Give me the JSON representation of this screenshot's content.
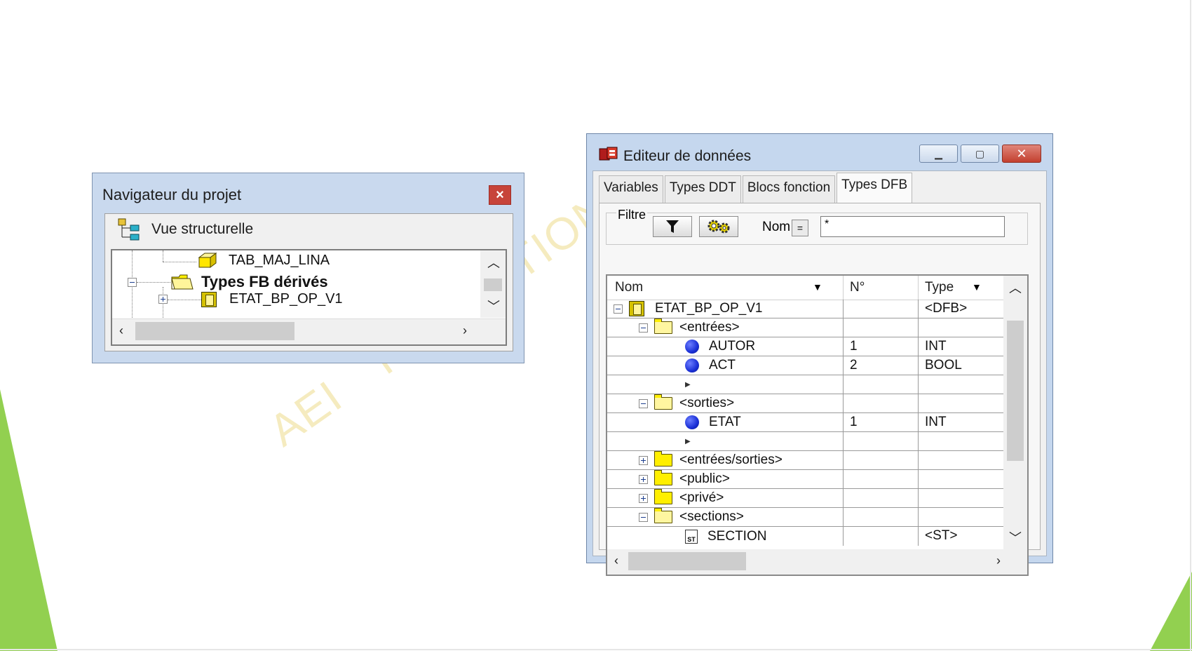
{
  "navigator": {
    "title": "Navigateur du projet",
    "close_label": "×",
    "view_label": "Vue structurelle",
    "tree": [
      {
        "label": "TAB_MAJ_LINA",
        "icon": "yellow-cube-icon"
      },
      {
        "label": "Types FB dérivés",
        "icon": "open-folder-icon",
        "bold": true
      },
      {
        "label": "ETAT_BP_OP_V1",
        "icon": "function-block-icon"
      }
    ]
  },
  "editor": {
    "title": "Editeur de données",
    "tabs": [
      "Variables",
      "Types DDT",
      "Blocs fonction",
      "Types DFB"
    ],
    "active_tab": "Types DFB",
    "filter": {
      "group_label": "Filtre",
      "nom_label": "Nom",
      "equals_label": "=",
      "value": "*"
    },
    "columns": [
      "Nom",
      "N°",
      "Type"
    ],
    "rows": [
      {
        "name": "ETAT_BP_OP_V1",
        "num": "",
        "type": "<DFB>",
        "icon": "function-block-icon"
      },
      {
        "name": "<entrées>",
        "num": "",
        "type": "",
        "icon": "open-folder-icon"
      },
      {
        "name": "AUTOR",
        "num": "1",
        "type": "INT",
        "icon": "blue-dot-icon"
      },
      {
        "name": "ACT",
        "num": "2",
        "type": "BOOL",
        "icon": "blue-dot-icon"
      },
      {
        "name": "",
        "num": "",
        "type": "",
        "icon": "new-entry-arrow-icon"
      },
      {
        "name": "<sorties>",
        "num": "",
        "type": "",
        "icon": "open-folder-icon"
      },
      {
        "name": "ETAT",
        "num": "1",
        "type": "INT",
        "icon": "blue-dot-icon"
      },
      {
        "name": "",
        "num": "",
        "type": "",
        "icon": "new-entry-arrow-icon"
      },
      {
        "name": "<entrées/sorties>",
        "num": "",
        "type": "",
        "icon": "folder-icon"
      },
      {
        "name": "<public>",
        "num": "",
        "type": "",
        "icon": "folder-icon"
      },
      {
        "name": "<privé>",
        "num": "",
        "type": "",
        "icon": "folder-icon"
      },
      {
        "name": "<sections>",
        "num": "",
        "type": "",
        "icon": "open-folder-icon"
      },
      {
        "name": "SECTION",
        "num": "",
        "type": "<ST>",
        "icon": "st-section-icon"
      }
    ]
  },
  "watermark": {
    "words": [
      "AEI",
      "FORMATION"
    ]
  },
  "colors": {
    "accent_green": "#92d050",
    "watermark": "#f3e7b0",
    "window_frame": "#c9d9ee",
    "close_red": "#c7443a"
  }
}
